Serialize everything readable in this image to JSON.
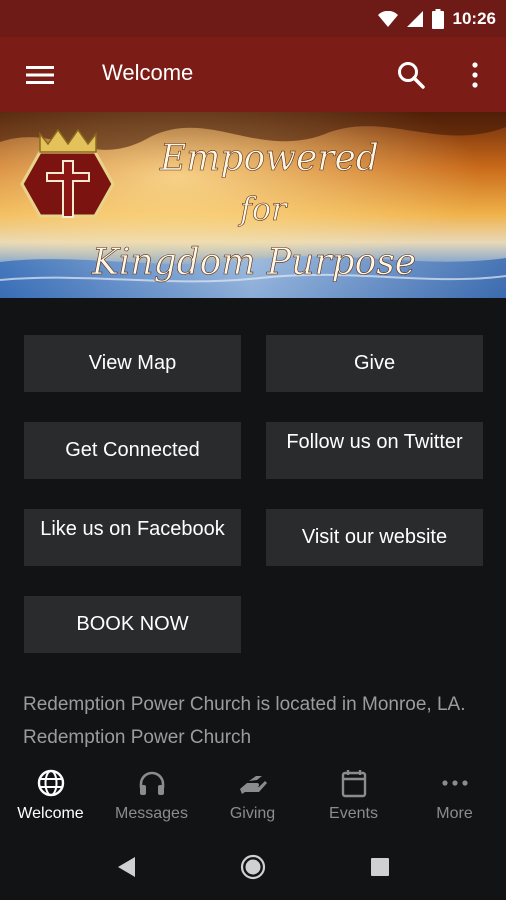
{
  "status_bar": {
    "time": "10:26"
  },
  "app_bar": {
    "title": "Welcome"
  },
  "banner": {
    "line1": "Empowered",
    "line2": "for",
    "line3": "Kingdom Purpose"
  },
  "buttons": [
    {
      "label": "View Map"
    },
    {
      "label": "Give"
    },
    {
      "label": "Get Connected"
    },
    {
      "label": "Follow us on Twitter"
    },
    {
      "label": "Like us on Facebook"
    },
    {
      "label": "Visit our website"
    },
    {
      "label": "BOOK NOW"
    }
  ],
  "description": "Redemption Power Church is located in Monroe, LA.  Redemption Power Church",
  "bottom_nav": [
    {
      "label": "Welcome",
      "icon": "globe-icon",
      "active": true
    },
    {
      "label": "Messages",
      "icon": "headphones-icon"
    },
    {
      "label": "Giving",
      "icon": "giving-hand-icon"
    },
    {
      "label": "Events",
      "icon": "calendar-icon"
    },
    {
      "label": "More",
      "icon": "more-dots-icon"
    }
  ],
  "colors": {
    "status_bar": "#6e1a16",
    "app_bar": "#7b1c17",
    "background": "#121314",
    "button": "#2a2b2c"
  }
}
